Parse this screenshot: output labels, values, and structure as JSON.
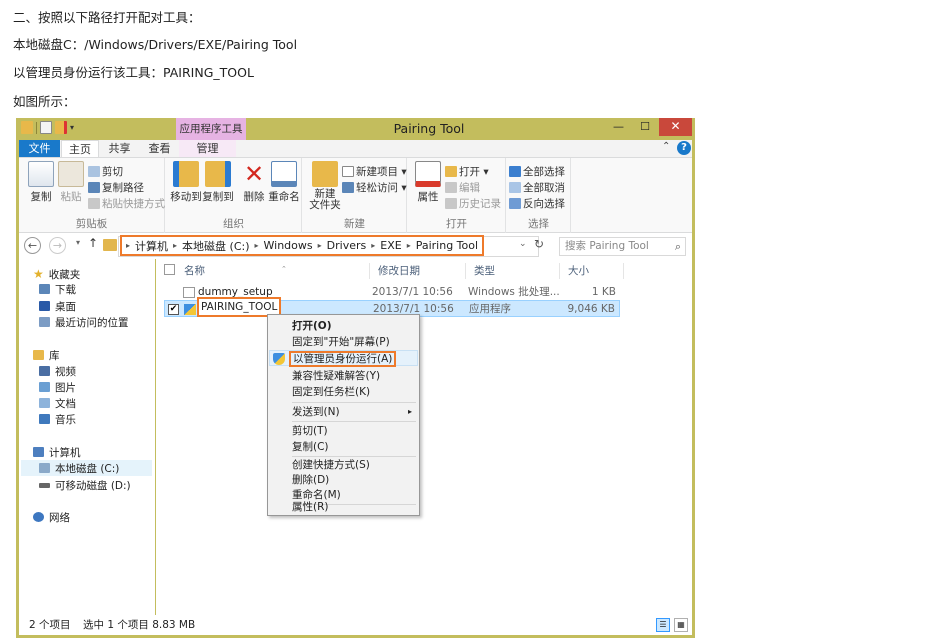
{
  "document": {
    "lines": [
      "二、按照以下路径打开配对工具：",
      "本地磁盘C：/Windows/Drivers/EXE/Pairing Tool",
      "以管理员身份运行该工具：PAIRING_TOOL",
      "如图所示："
    ]
  },
  "window": {
    "title": "Pairing Tool",
    "contextual_tab_header": "应用程序工具",
    "controls": {
      "minimize": "—",
      "maximize": "☐",
      "close": "✕"
    },
    "qa_arrow": "▾"
  },
  "tabs": {
    "file": "文件",
    "home": "主页",
    "share": "共享",
    "view": "查看",
    "manage": "管理",
    "ribbon_caret": "⌃",
    "help": "?"
  },
  "ribbon": {
    "clipboard": {
      "label": "剪贴板",
      "copy": "复制",
      "paste": "粘贴",
      "cut": "剪切",
      "copy_path": "复制路径",
      "paste_shortcut": "粘贴快捷方式"
    },
    "organize": {
      "label": "组织",
      "move_to": "移动到",
      "copy_to": "复制到",
      "delete": "删除",
      "rename": "重命名"
    },
    "new": {
      "label": "新建",
      "new_folder": "新建\n文件夹",
      "new_item": "新建项目 ▾",
      "easy_access": "轻松访问 ▾"
    },
    "open": {
      "label": "打开",
      "properties": "属性",
      "open": "打开 ▾",
      "edit": "编辑",
      "history": "历史记录"
    },
    "select": {
      "label": "选择",
      "select_all": "全部选择",
      "select_none": "全部取消",
      "invert": "反向选择"
    }
  },
  "address": {
    "back": "←",
    "forward": "→",
    "recent": "▾",
    "up": "↑",
    "crumb_arrow": "▸",
    "crumbs": [
      "计算机",
      "本地磁盘 (C:)",
      "Windows",
      "Drivers",
      "EXE",
      "Pairing Tool"
    ],
    "dropdown": "⌄",
    "refresh": "↻",
    "search_placeholder": "搜索 Pairing Tool",
    "search_icon": "⌕"
  },
  "nav": {
    "favorites": "收藏夹",
    "downloads": "下载",
    "desktop": "桌面",
    "recent": "最近访问的位置",
    "libraries": "库",
    "videos": "视频",
    "pictures": "图片",
    "documents": "文档",
    "music": "音乐",
    "computer": "计算机",
    "local_disk": "本地磁盘 (C:)",
    "removable": "可移动磁盘 (D:)",
    "network": "网络"
  },
  "columns": {
    "name": "名称",
    "date": "修改日期",
    "type": "类型",
    "size": "大小",
    "sort_indicator": "⌃"
  },
  "files": [
    {
      "name": "dummy_setup",
      "date": "2013/7/1 10:56",
      "type": "Windows 批处理...",
      "size": "1 KB"
    },
    {
      "name": "PAIRING_TOOL",
      "date": "2013/7/1 10:56",
      "type": "应用程序",
      "size": "9,046 KB",
      "checked": "✔"
    }
  ],
  "context_menu": {
    "open": "打开(O)",
    "pin_start": "固定到\"开始\"屏幕(P)",
    "run_as_admin": "以管理员身份运行(A)",
    "troubleshoot": "兼容性疑难解答(Y)",
    "pin_taskbar": "固定到任务栏(K)",
    "send_to": "发送到(N)",
    "cut": "剪切(T)",
    "copy": "复制(C)",
    "create_shortcut": "创建快捷方式(S)",
    "delete": "删除(D)",
    "rename": "重命名(M)",
    "properties": "属性(R)",
    "submenu_arrow": "▸"
  },
  "status": {
    "items": "2 个项目",
    "selected": "选中 1 个项目  8.83 MB",
    "details_view": "☰",
    "icons_view": "▦"
  },
  "colors": {
    "accent": "#1979ca",
    "highlight_box": "#ee7a2b",
    "window_border": "#c3bd5d",
    "context_tab": "#e6b3e3"
  }
}
